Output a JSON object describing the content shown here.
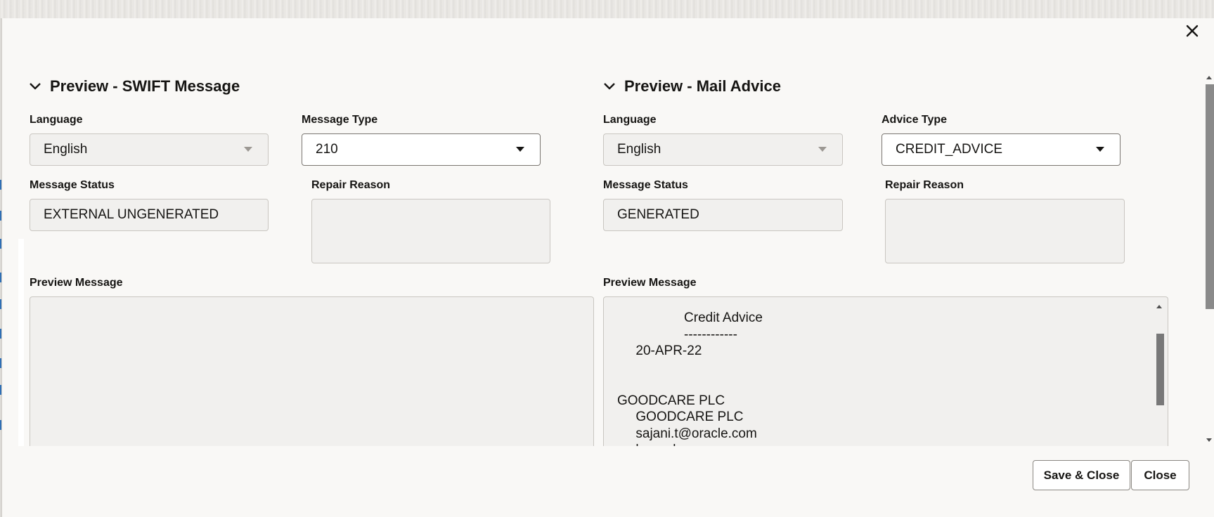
{
  "swift": {
    "section_title": "Preview - SWIFT Message",
    "language_label": "Language",
    "language_value": "English",
    "message_type_label": "Message Type",
    "message_type_value": "210",
    "message_status_label": "Message Status",
    "message_status_value": "EXTERNAL UNGENERATED",
    "repair_reason_label": "Repair Reason",
    "repair_reason_value": "",
    "preview_label": "Preview Message",
    "preview_text": ""
  },
  "mail": {
    "section_title": "Preview - Mail Advice",
    "language_label": "Language",
    "language_value": "English",
    "advice_type_label": "Advice Type",
    "advice_type_value": "CREDIT_ADVICE",
    "message_status_label": "Message Status",
    "message_status_value": "GENERATED",
    "repair_reason_label": "Repair Reason",
    "repair_reason_value": "",
    "preview_label": "Preview Message",
    "preview_text": "                  Credit Advice\n                  ------------\n     20-APR-22\n\n\nGOODCARE PLC\n     GOODCARE PLC\n     sajani.t@oracle.com\n     bangalore"
  },
  "footer": {
    "save_close_label": "Save & Close",
    "close_label": "Close"
  },
  "icons": {
    "dialog_close": "close-icon",
    "section_toggle": "chevron-down-icon",
    "dropdown": "caret-down-icon"
  }
}
